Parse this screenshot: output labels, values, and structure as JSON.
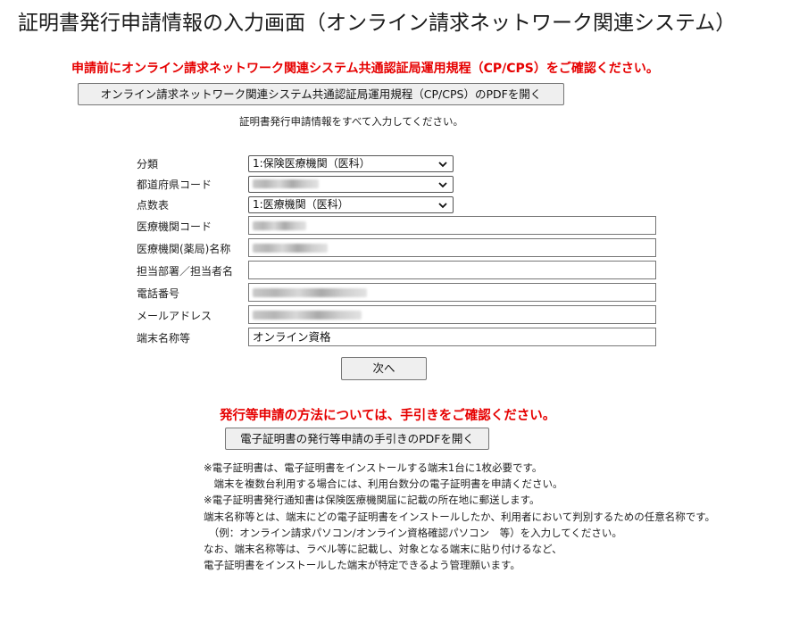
{
  "page": {
    "title": "証明書発行申請情報の入力画面（オンライン請求ネットワーク関連システム）"
  },
  "notice_top": "申請前にオンライン請求ネットワーク関連システム共通認証局運用規程（CP/CPS）をご確認ください。",
  "cp_pdf_button": "オンライン請求ネットワーク関連システム共通認証局運用規程（CP/CPS）のPDFを開く",
  "instruction": "証明書発行申請情報をすべて入力してください。",
  "form": {
    "category": {
      "label": "分類",
      "value": "1:保険医療機関（医科）"
    },
    "prefecture_code": {
      "label": "都道府県コード",
      "value": ""
    },
    "score_table": {
      "label": "点数表",
      "value": "1:医療機関（医科）"
    },
    "institution_code": {
      "label": "医療機関コード",
      "value": ""
    },
    "institution_name": {
      "label": "医療機関(薬局)名称",
      "value": ""
    },
    "department": {
      "label": "担当部署／担当者名",
      "value": ""
    },
    "phone": {
      "label": "電話番号",
      "value": ""
    },
    "email": {
      "label": "メールアドレス",
      "value": ""
    },
    "terminal_name": {
      "label": "端末名称等",
      "value": "オンライン資格"
    }
  },
  "next_button": "次へ",
  "notice_bottom": "発行等申請の方法については、手引きをご確認ください。",
  "guide_pdf_button": "電子証明書の発行等申請の手引きのPDFを開く",
  "notes": [
    "※電子証明書は、電子証明書をインストールする端末1台に1枚必要です。",
    "　端末を複数台利用する場合には、利用台数分の電子証明書を申請ください。",
    "※電子証明書発行通知書は保険医療機関届に記載の所在地に郵送します。",
    "端末名称等とは、端末にどの電子証明書をインストールしたか、利用者において判別するための任意名称です。",
    "　（例：オンライン請求パソコン/オンライン資格確認パソコン　等）を入力してください。",
    "なお、端末名称等は、ラベル等に記載し、対象となる端末に貼り付けるなど、",
    "電子証明書をインストールした端末が特定できるよう管理願います。"
  ],
  "icons": {
    "dropdown": "chevron-down-icon"
  }
}
